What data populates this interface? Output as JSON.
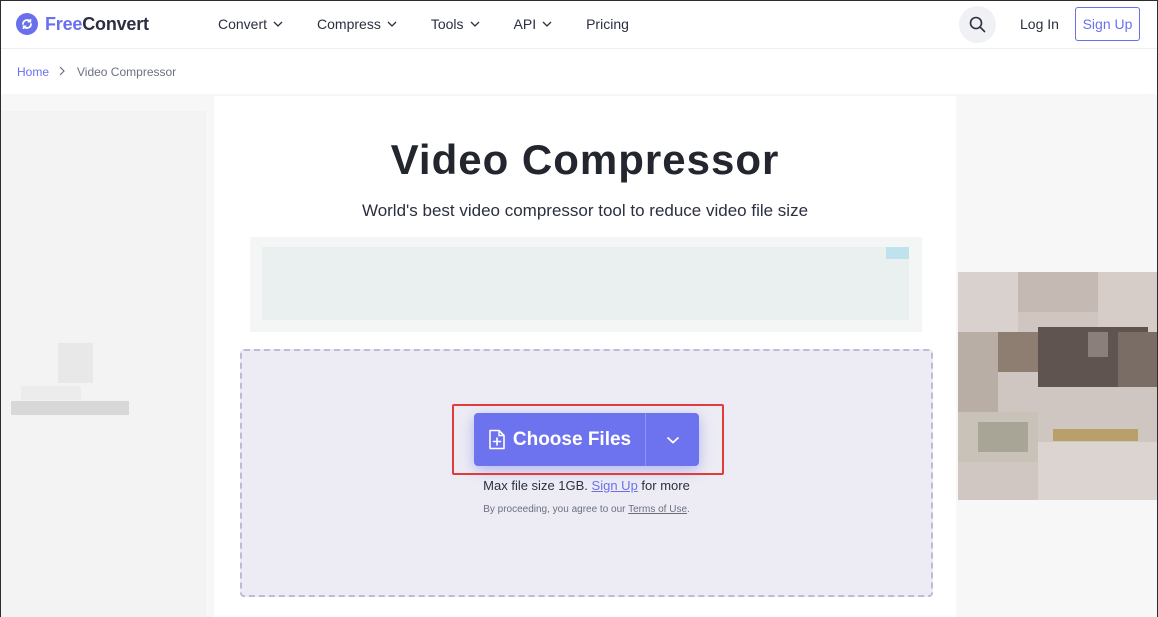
{
  "brand": {
    "prefix": "Free",
    "suffix": "Convert"
  },
  "nav": {
    "items": [
      {
        "label": "Convert",
        "dropdown": true
      },
      {
        "label": "Compress",
        "dropdown": true
      },
      {
        "label": "Tools",
        "dropdown": true
      },
      {
        "label": "API",
        "dropdown": true
      },
      {
        "label": "Pricing",
        "dropdown": false
      }
    ],
    "login_label": "Log In",
    "signup_label": "Sign Up"
  },
  "breadcrumb": {
    "home": "Home",
    "current": "Video Compressor"
  },
  "main": {
    "title": "Video Compressor",
    "subtitle": "World's best video compressor tool to reduce video file size"
  },
  "upload": {
    "choose_label": "Choose Files",
    "max_prefix": "Max file size 1GB.",
    "max_link": "Sign Up",
    "max_suffix": "for more",
    "terms_prefix": "By proceeding, you agree to our",
    "terms_link": "Terms of Use",
    "terms_suffix": "."
  },
  "colors": {
    "accent": "#6a70ec",
    "highlight": "#e23b3b",
    "dropzone": "#edecf4"
  }
}
